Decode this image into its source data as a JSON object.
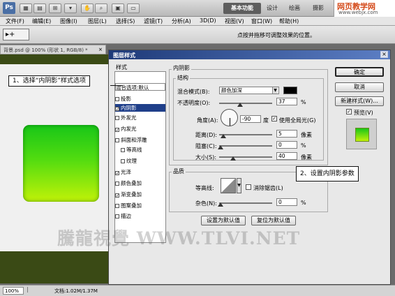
{
  "app": {
    "logo_text": "Ps",
    "workspaces": [
      "基本功能",
      "设计",
      "绘画",
      "摄影"
    ],
    "site_logo": "网页教学网",
    "site_url": "www.webjx.com"
  },
  "menu": [
    "文件(F)",
    "编辑(E)",
    "图像(I)",
    "图层(L)",
    "选择(S)",
    "滤镜(T)",
    "分析(A)",
    "3D(D)",
    "视图(V)",
    "窗口(W)",
    "帮助(H)"
  ],
  "options_bar": {
    "tool_glyph": "▸+",
    "hint": "点按并拖移可调整效果的位置。"
  },
  "document": {
    "tab_title": "背景.psd @ 100% (形状 1, RGB/8) *",
    "close": "×",
    "zoom": "100%",
    "doc_size": "文档:1.02M/1.37M"
  },
  "dialog": {
    "title": "图层样式",
    "close": "×",
    "styles_header": "样式",
    "style_items": [
      {
        "label": "混合选项:默认",
        "checked": null
      },
      {
        "label": "投影",
        "checked": false
      },
      {
        "label": "内阴影",
        "checked": true,
        "selected": true
      },
      {
        "label": "外发光",
        "checked": false
      },
      {
        "label": "内发光",
        "checked": true
      },
      {
        "label": "斜面和浮雕",
        "checked": false
      },
      {
        "label": "等高线",
        "checked": false
      },
      {
        "label": "纹理",
        "checked": false
      },
      {
        "label": "光泽",
        "checked": true
      },
      {
        "label": "颜色叠加",
        "checked": false
      },
      {
        "label": "渐变叠加",
        "checked": true
      },
      {
        "label": "图案叠加",
        "checked": false
      },
      {
        "label": "描边",
        "checked": false
      }
    ],
    "inner_shadow": {
      "section_title": "内阴影",
      "structure_title": "结构",
      "blend_mode_label": "混合模式(B):",
      "blend_mode_value": "颜色加深",
      "shadow_color": "#000000",
      "opacity_label": "不透明度(O):",
      "opacity_value": "37",
      "opacity_unit": "%",
      "angle_label": "角度(A):",
      "angle_value": "-90",
      "angle_unit": "度",
      "global_light_label": "使用全局光(G)",
      "global_light_checked": true,
      "distance_label": "距离(D):",
      "distance_value": "5",
      "distance_unit": "像素",
      "choke_label": "阻塞(C):",
      "choke_value": "0",
      "choke_unit": "%",
      "size_label": "大小(S):",
      "size_value": "40",
      "size_unit": "像素",
      "quality_title": "品质",
      "contour_label": "等高线:",
      "antialias_label": "消除锯齿(L)",
      "antialias_checked": false,
      "noise_label": "杂色(N):",
      "noise_value": "0",
      "noise_unit": "%",
      "make_default": "设置为默认值",
      "reset_default": "复位为默认值"
    },
    "buttons": {
      "ok": "确定",
      "cancel": "取消",
      "new_style": "新建样式(W)...",
      "preview_label": "预览(V)",
      "preview_checked": true
    }
  },
  "callouts": {
    "step1": "1、选择“内阴影”样式选项",
    "step2": "2、设置内阴影参数"
  },
  "watermark": "騰龍視覺 WWW.TLVI.NET",
  "colors": {
    "selection_blue": "#1f3f8a",
    "title_bar_blue": "#1e3a78",
    "green_light": "#c2f208",
    "green_dark": "#18c618",
    "olive_stripe": "#3a4a15"
  }
}
